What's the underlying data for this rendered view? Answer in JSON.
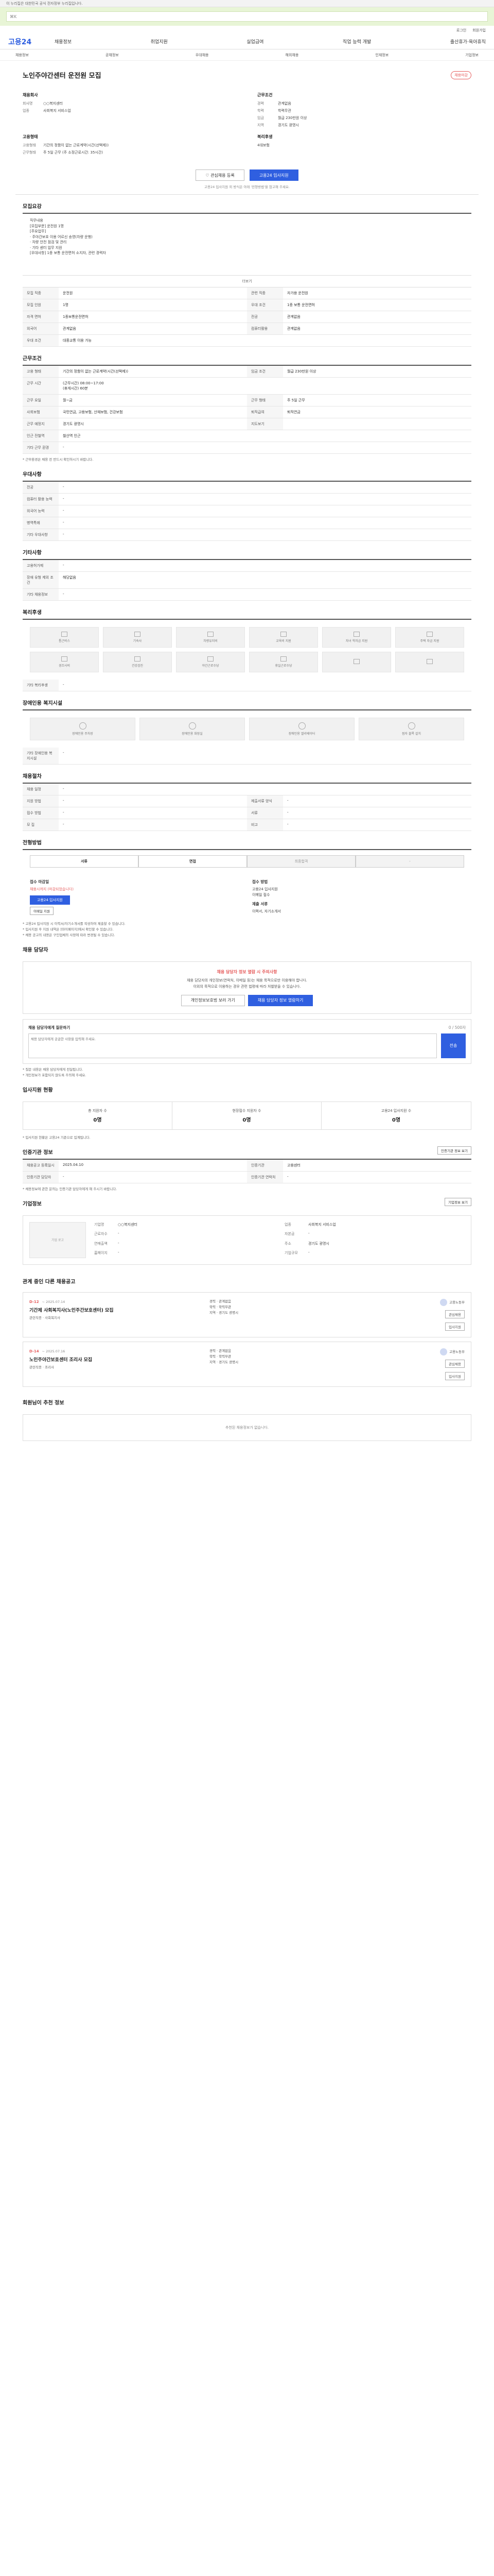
{
  "topbar": {
    "notice": "이 누리집은 대한민국 공식 전자정부 누리집입니다."
  },
  "search": {
    "shortcut": "⌘K",
    "placeholder": ""
  },
  "util": {
    "items": [
      "로그인",
      "회원가입"
    ]
  },
  "gnb": {
    "logo": "고용24",
    "menu": [
      "채용정보",
      "취업지원",
      "실업급여",
      "직업 능력 개발",
      "출산휴가·육아휴직"
    ]
  },
  "subnav": {
    "items": [
      "채용정보",
      "공채정보",
      "우대채용",
      "해외채용",
      "인재정보",
      "기업정보"
    ]
  },
  "job": {
    "title": "노인주야간센터 운전원 모집",
    "badge": "채용마감",
    "company_h": "채용회사",
    "company": {
      "company_name_k": "회사명",
      "company_name": "○○복지센터",
      "biz_k": "업종",
      "biz": "사회복지 서비스업"
    },
    "cond_h": "근무조건",
    "cond": [
      {
        "k": "경력",
        "v": "관계없음"
      },
      {
        "k": "학력",
        "v": "학력무관"
      },
      {
        "k": "임금",
        "v": "월급 230만원 이상"
      },
      {
        "k": "지역",
        "v": "경기도 광명시"
      }
    ],
    "form_h": "고용형태",
    "form": [
      {
        "k": "고용형태",
        "v": "기간의 정함이 없는 근로계약(시간(선택제))"
      },
      {
        "k": "근무형태",
        "v": "주 5일 근무 (주 소정근로시간: 35시간)"
      }
    ],
    "welfare_h": "복리후생",
    "welfare": "4대보험",
    "btn_scrap": "관심채용 등록",
    "btn_apply": "고용24 입사지원",
    "note": "고용24 입사지원 외 방식은 아래 '전형방법'을 참고해 주세요."
  },
  "sections": {
    "recruit_h": "모집요강",
    "recruit_body": "직무내용\n[모집부문] 운전원 1명\n[주요업무]\n · 주야간보호 이용 어르신 송영(차량 운행)\n · 차량 안전 점검 및 관리\n · 기타 센터 업무 지원\n[우대사항] 1종 보통 운전면허 소지자, 관련 경력자",
    "recruit_more": "더보기",
    "recruit_rows": [
      {
        "k": "모집 직종",
        "v": "운전원",
        "k2": "관련 직종",
        "v2": "자가용 운전원"
      },
      {
        "k": "모집 인원",
        "v": "1명",
        "k2": "우대 조건",
        "v2": "1종 보통 운전면허"
      },
      {
        "k": "자격 면허",
        "v": "1종보통운전면허",
        "k2": "전공",
        "v2": "관계없음"
      },
      {
        "k": "외국어",
        "v": "관계없음",
        "k2": "컴퓨터활용",
        "v2": "관계없음"
      },
      {
        "k": "우대 조건",
        "v": "대중교통 이용 가능",
        "k2": "",
        "v2": ""
      }
    ],
    "work_h": "근무조건",
    "work_rows": [
      {
        "k": "고용 형태",
        "v": "기간의 정함이 없는 근로계약(시간(선택제))",
        "k2": "임금 조건",
        "v2": "월급 230만원 이상"
      },
      {
        "k": "근무 시간",
        "v": "(근무시간) 08:00~17:00\n(휴게시간) 60분",
        "k2": "",
        "v2": ""
      },
      {
        "k": "근무 요일",
        "v": "월~금",
        "k2": "근무 형태",
        "v2": "주 5일 근무"
      },
      {
        "k": "사회보험",
        "v": "국민연금, 고용보험, 산재보험, 건강보험",
        "k2": "퇴직급여",
        "v2": "퇴직연금"
      },
      {
        "k": "근무 예정지",
        "v": "경기도 광명시",
        "k2": "지도보기",
        "v2": ""
      },
      {
        "k": "인근 전철역",
        "v": "철산역 인근",
        "k2": "",
        "v2": ""
      },
      {
        "k": "기타 근무 환경",
        "v": "-",
        "k2": "",
        "v2": ""
      }
    ],
    "work_note": "* 근무환경은 채용 전 반드시 확인하시기 바랍니다.",
    "pref_h": "우대사항",
    "pref_rows": [
      {
        "k": "전공",
        "v": "-"
      },
      {
        "k": "컴퓨터 활용 능력",
        "v": "-"
      },
      {
        "k": "외국어 능력",
        "v": "-"
      },
      {
        "k": "병역특례",
        "v": "-"
      },
      {
        "k": "기타 우대사항",
        "v": "-"
      }
    ],
    "etc_h": "기타사항",
    "etc_rows": [
      {
        "k": "고용허가제",
        "v": "-"
      },
      {
        "k": "장애 유형 제외 조건",
        "v": "해당없음"
      },
      {
        "k": "기타 채용정보",
        "v": "-"
      }
    ],
    "benefit_h": "복리후생",
    "benefits": [
      "통근버스",
      "기숙사",
      "차량유지비",
      "교육비 지원",
      "자녀 학자금 지원",
      "주택 자금 지원",
      "경조사비",
      "건강검진",
      "야간근로수당",
      "휴일근로수당",
      "",
      ""
    ],
    "benefit_etc_k": "기타 복리후생",
    "benefit_etc_v": "-",
    "facility_h": "장애인용 복지시설",
    "facilities": [
      "장애인용 주차장",
      "장애인용 화장실",
      "장애인용 엘리베이터",
      "점자 블록 설치"
    ],
    "facility_etc_k": "기타 장애인용 복지시설",
    "facility_etc_v": "-",
    "recruit_info_h": "채용절차",
    "recruit_info_rows": [
      {
        "k": "채용 일정",
        "v": "-",
        "k2": "",
        "v2": ""
      },
      {
        "k": "지원 방법",
        "v": "-",
        "k2": "제출서류 양식",
        "v2": "-"
      },
      {
        "k": "접수 방법",
        "v": "-",
        "k2": "서류",
        "v2": "-"
      },
      {
        "k": "모 집",
        "v": "-",
        "k2": "비고",
        "v2": "-"
      }
    ],
    "steps_h": "전형방법",
    "steps": [
      "서류",
      "면접",
      "최종합격",
      "-"
    ],
    "apply_h": "접수 마감일",
    "apply_deadline": "채용시까지 (마감되었습니다)",
    "apply_method_h": "접수 방법",
    "apply_method": "고용24 입사지원\n이메일 접수",
    "apply_btn": "고용24 입사지원",
    "apply_small": "이메일 지원",
    "apply_docs_h": "제출 서류",
    "apply_docs": "이력서, 자기소개서",
    "bullets": [
      "* 고용24 입사지원 시 이력서/자기소개서를 작성하여 제출할 수 있습니다.",
      "* 입사지원 후 지원 내역은 [마이페이지]에서 확인할 수 있습니다.",
      "* 채용 공고의 내용은 구인업체의 사정에 따라 변경될 수 있습니다."
    ],
    "manager_h": "채용 담당자",
    "warn_t": "채용 담당자 정보 열람 시 주의사항",
    "warn_p": "채용 담당자의 개인정보(연락처, 이메일 등)는 채용 목적으로만 이용해야 합니다.\n이외의 목적으로 이용하는 경우 관련 법령에 따라 처벌받을 수 있습니다.",
    "warn_btn1": "개인정보보호법 보러 가기",
    "warn_btn2": "채용 담당자 정보 열람하기",
    "qna_h": "채용 담당자에게 질문하기",
    "qna_count": "0 / 500자",
    "qna_ph": "채용 담당자에게 궁금한 사항을 입력해 주세요.",
    "qna_send": "전송",
    "qna_bullets": [
      "* 질문 내용은 채용 담당자에게 전달됩니다.",
      "* 개인정보가 포함되지 않도록 주의해 주세요."
    ],
    "status_h": "입사지원 현황",
    "status": [
      {
        "k": "총 지원자 수",
        "v": "0명"
      },
      {
        "k": "현장접수 지원자 수",
        "v": "0명"
      },
      {
        "k": "고용24 입사지원 수",
        "v": "0명"
      }
    ],
    "status_note": "* 입사지원 현황은 고용24 기준으로 집계됩니다.",
    "info_h": "인증기관 정보",
    "info_btn": "인증기관 정보 보기",
    "info_rows": [
      {
        "k": "채용공고 등록일시",
        "v": "2025.04.10",
        "k2": "인증기관",
        "v2": "고용센터"
      },
      {
        "k": "인증기관 담당자",
        "v": "-",
        "k2": "인증기관 연락처",
        "v2": "-"
      }
    ],
    "info_note": "* 채용정보에 관한 문의는 인증기관 담당자에게 해 주시기 바랍니다.",
    "company_h": "기업정보",
    "company_logo": "기업 로고",
    "company_btn": "기업정보 보기",
    "company_rows": [
      {
        "k": "기업명",
        "v": "○○복지센터"
      },
      {
        "k": "업종",
        "v": "사회복지 서비스업"
      },
      {
        "k": "근로자수",
        "v": "-"
      },
      {
        "k": "자본금",
        "v": "-"
      },
      {
        "k": "연매출액",
        "v": "-"
      },
      {
        "k": "주소",
        "v": "경기도 광명시"
      },
      {
        "k": "홈페이지",
        "v": "-"
      },
      {
        "k": "기업규모",
        "v": "-"
      }
    ],
    "similar_h": "관계 중인 다른 채용공고",
    "cards": [
      {
        "dday": "D-12",
        "date": "~ 2025.07.14",
        "title": "기간제 사회복지사(노인주간보호센터) 모집",
        "meta": "관련직종 · 사회복지사",
        "mid": "경력 · 관계없음\n학력 · 학력무관\n지역 · 경기도 광명시",
        "org": "고용노동부",
        "btn1": "관심채용",
        "btn2": "입사지원"
      },
      {
        "dday": "D-14",
        "date": "~ 2025.07.16",
        "title": "노인주야간보호센터 조리사 모집",
        "meta": "관련직종 · 조리사",
        "mid": "경력 · 관계없음\n학력 · 학력무관\n지역 · 경기도 광명시",
        "org": "고용노동부",
        "btn1": "관심채용",
        "btn2": "입사지원"
      }
    ],
    "rec_h": "회원님이 추천 정보",
    "rec_empty": "추천된 채용정보가 없습니다."
  }
}
